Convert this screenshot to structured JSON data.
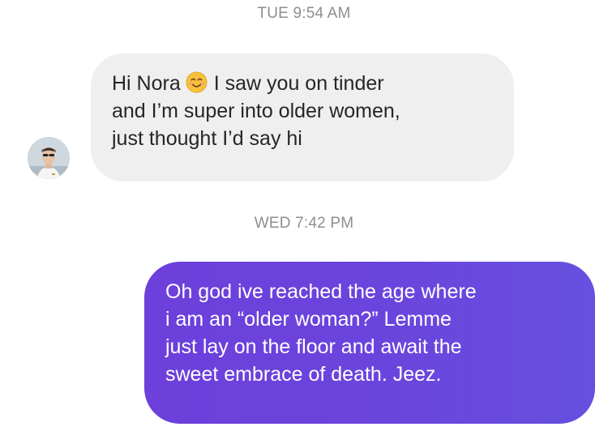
{
  "thread": {
    "timestamp_1": "TUE 9:54 AM",
    "timestamp_2": "WED 7:42 PM"
  },
  "received": {
    "line1_before_emoji": "Hi Nora",
    "emoji": "smiling-face-emoji",
    "line1_after_emoji": "I saw you on tinder",
    "line2": "and I’m super into older women,",
    "line3": "just thought I’d say hi"
  },
  "sent": {
    "line1": "Oh god ive reached the age where",
    "line2": "i am an “older woman?” Lemme",
    "line3": "just lay on the floor and await the",
    "line4": "sweet embrace of death. Jeez."
  },
  "colors": {
    "received_bubble": "#efefef",
    "sent_bubble_start": "#6d3fdb",
    "sent_bubble_end": "#6650df",
    "timestamp": "#8e8e8e"
  }
}
